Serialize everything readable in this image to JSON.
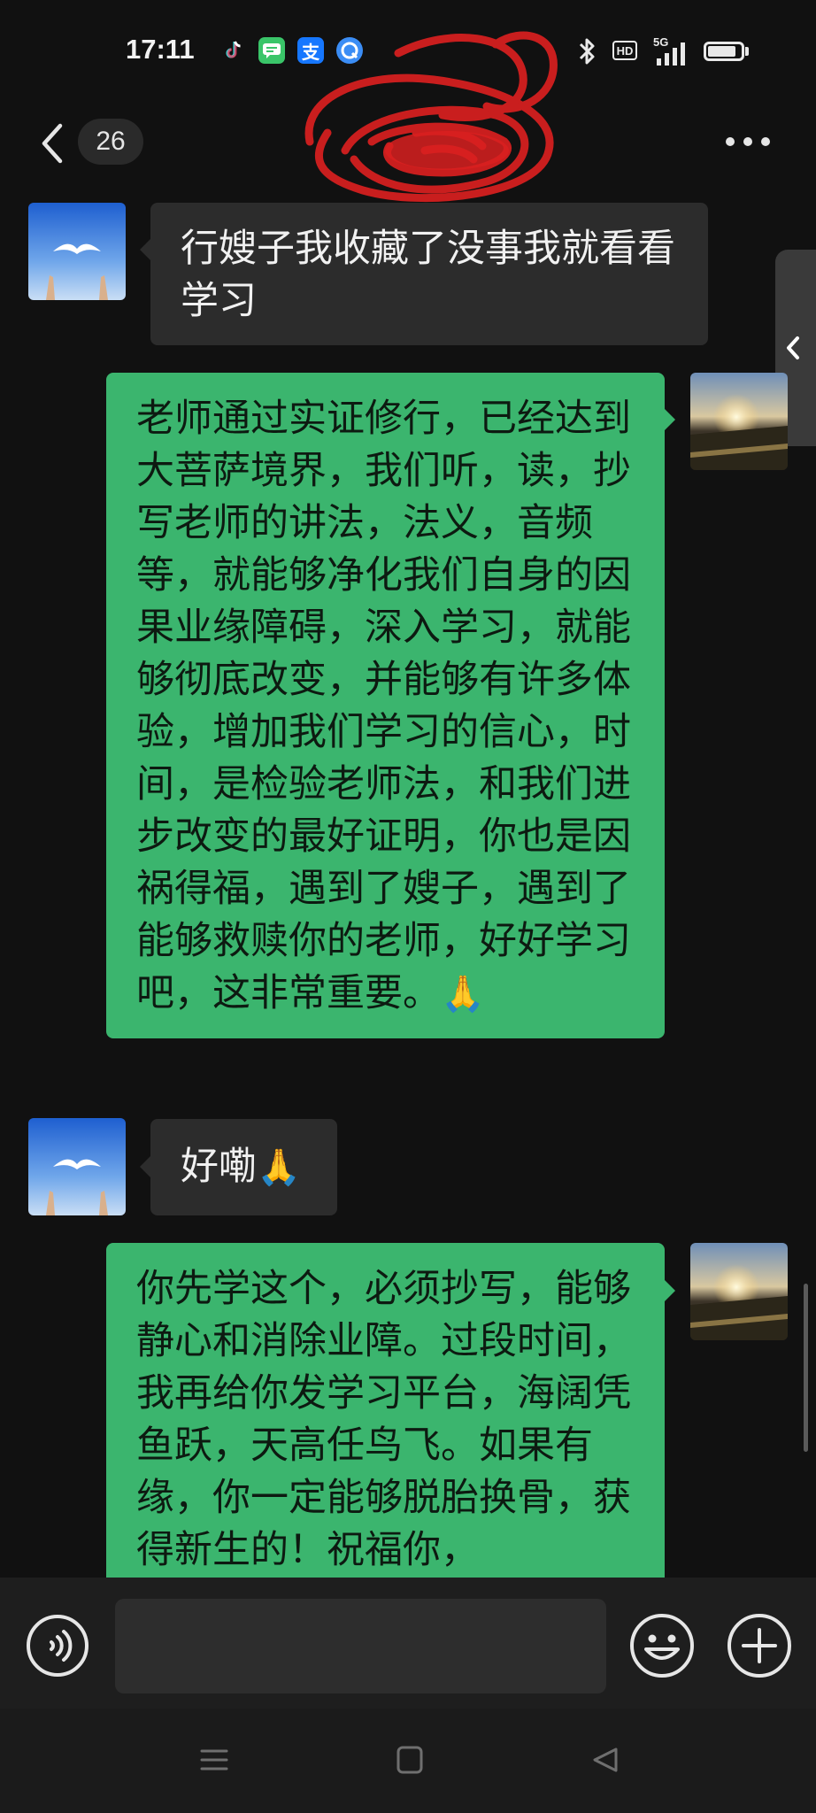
{
  "status_bar": {
    "time": "17:11",
    "hd_label": "HD",
    "network_label": "5G",
    "battery_fraction": 0.85,
    "app_icons": [
      "tiktok-icon",
      "message-icon",
      "alipay-icon",
      "browser-icon"
    ],
    "alipay_glyph": "支"
  },
  "header": {
    "unread_count": "26"
  },
  "messages": [
    {
      "direction": "incoming",
      "text": "行嫂子我收藏了没事我就看看学习"
    },
    {
      "direction": "outgoing",
      "text": "老师通过实证修行，已经达到大菩萨境界，我们听，读，抄写老师的讲法，法义，音频等，就能够净化我们自身的因果业缘障碍，深入学习，就能够彻底改变，并能够有许多体验，增加我们学习的信心，时间，是检验老师法，和我们进步改变的最好证明，你也是因祸得福，遇到了嫂子，遇到了能够救赎你的老师，好好学习吧，这非常重要。"
    },
    {
      "direction": "incoming",
      "text": "好嘞"
    },
    {
      "direction": "outgoing",
      "text": "你先学这个，必须抄写，能够静心和消除业障。过段时间，我再给你发学习平台，海阔凭鱼跃，天高任鸟飞。如果有缘，你一定能够脱胎换骨，获得新生的！祝福你，"
    }
  ],
  "input": {
    "value": "",
    "placeholder": ""
  },
  "colors": {
    "background": "#111111",
    "incoming_bubble": "#2c2c2c",
    "outgoing_bubble": "#3bb56e",
    "accent_alipay": "#1677ff"
  }
}
